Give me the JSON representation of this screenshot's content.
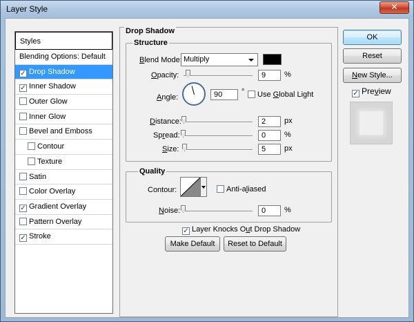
{
  "window": {
    "title": "Layer Style",
    "close_glyph": "✕"
  },
  "styles_list": {
    "header": "Styles",
    "blending_options": "Blending Options: Default",
    "items": [
      {
        "label": "Drop Shadow",
        "checked": true,
        "selected": true,
        "indent": false
      },
      {
        "label": "Inner Shadow",
        "checked": true,
        "selected": false,
        "indent": false
      },
      {
        "label": "Outer Glow",
        "checked": false,
        "selected": false,
        "indent": false
      },
      {
        "label": "Inner Glow",
        "checked": false,
        "selected": false,
        "indent": false
      },
      {
        "label": "Bevel and Emboss",
        "checked": false,
        "selected": false,
        "indent": false
      },
      {
        "label": "Contour",
        "checked": false,
        "selected": false,
        "indent": true
      },
      {
        "label": "Texture",
        "checked": false,
        "selected": false,
        "indent": true
      },
      {
        "label": "Satin",
        "checked": false,
        "selected": false,
        "indent": false
      },
      {
        "label": "Color Overlay",
        "checked": false,
        "selected": false,
        "indent": false
      },
      {
        "label": "Gradient Overlay",
        "checked": true,
        "selected": false,
        "indent": false
      },
      {
        "label": "Pattern Overlay",
        "checked": false,
        "selected": false,
        "indent": false
      },
      {
        "label": "Stroke",
        "checked": true,
        "selected": false,
        "indent": false
      }
    ]
  },
  "drop_shadow": {
    "title": "Drop Shadow",
    "structure": {
      "title": "Structure",
      "blend_mode_label_u": "B",
      "blend_mode_label_rest": "lend Mode:",
      "blend_mode_value": "Multiply",
      "shadow_color": "#000000",
      "opacity_label_u": "O",
      "opacity_label_rest": "pacity:",
      "opacity_value": "9",
      "opacity_unit": "%",
      "angle_label_u": "A",
      "angle_label_rest": "ngle:",
      "angle_value": "90",
      "angle_unit": "°",
      "use_global_light_label_u": "G",
      "use_global_light_pre": "Use ",
      "use_global_light_post": "lobal Light",
      "use_global_light_checked": false,
      "distance_label_u": "D",
      "distance_label_rest": "istance:",
      "distance_value": "2",
      "distance_unit": "px",
      "spread_label_pre": "Sp",
      "spread_label_u": "r",
      "spread_label_rest": "ead:",
      "spread_value": "0",
      "spread_unit": "%",
      "size_label_u": "S",
      "size_label_rest": "ize:",
      "size_value": "5",
      "size_unit": "px"
    },
    "quality": {
      "title": "Quality",
      "contour_label": "Contour:",
      "anti_aliased_pre": "Anti-a",
      "anti_aliased_u": "l",
      "anti_aliased_post": "iased",
      "anti_aliased_checked": false,
      "noise_label_u": "N",
      "noise_label_rest": "oise:",
      "noise_value": "0",
      "noise_unit": "%"
    },
    "knockout_pre": "Layer Knocks O",
    "knockout_u": "u",
    "knockout_post": "t Drop Shadow",
    "knockout_checked": true,
    "make_default": "Make Default",
    "reset_to_default": "Reset to Default"
  },
  "buttons": {
    "ok": "OK",
    "reset": "Reset",
    "new_style_u": "N",
    "new_style_rest": "ew Style...",
    "preview_u": "v",
    "preview_pre": "Pre",
    "preview_post": "iew",
    "preview_checked": true
  },
  "check_glyph": "✓"
}
